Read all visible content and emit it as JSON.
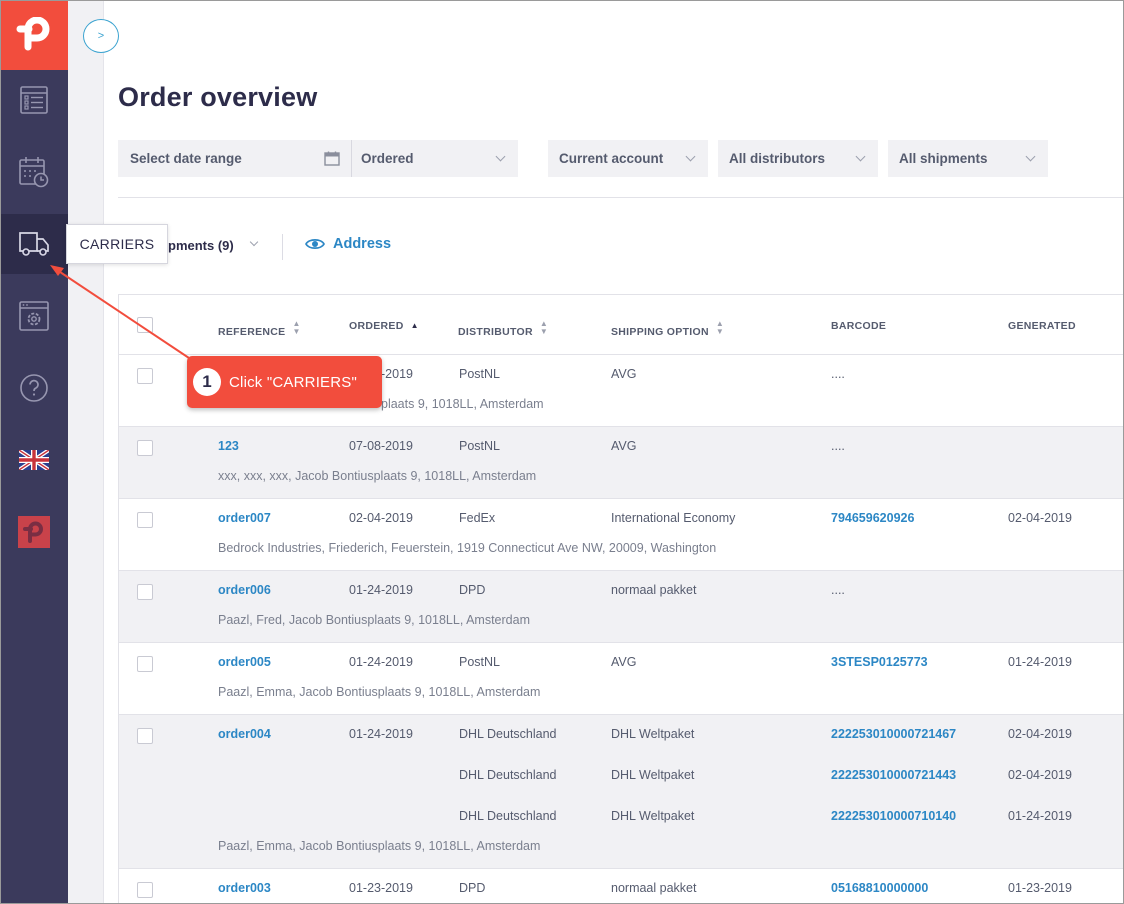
{
  "sidebar": {
    "items": [
      {
        "name": "orders",
        "icon": "orders-list-icon"
      },
      {
        "name": "calendar",
        "icon": "calendar-clock-icon"
      },
      {
        "name": "carriers",
        "icon": "truck-icon",
        "active": true
      },
      {
        "name": "settings",
        "icon": "settings-gear-icon"
      },
      {
        "name": "help",
        "icon": "help-question-icon"
      },
      {
        "name": "language",
        "icon": "uk-flag-icon"
      },
      {
        "name": "brand",
        "icon": "paazl-logo-icon"
      }
    ],
    "tooltip": "CARRIERS"
  },
  "toggle": {
    "label": ">"
  },
  "page": {
    "title": "Order overview"
  },
  "filters": {
    "date_range": "Select date range",
    "date_type": "Ordered",
    "account": "Current account",
    "distributors": "All distributors",
    "shipments": "All shipments"
  },
  "toolbar": {
    "shipments_label": "pments (9)",
    "address_label": "Address"
  },
  "table": {
    "headers": {
      "reference": "REFERENCE",
      "ordered": "ORDERED",
      "distributor": "DISTRIBUTOR",
      "shipping_option": "SHIPPING OPTION",
      "barcode": "BARCODE",
      "generated": "GENERATED"
    },
    "rows": [
      {
        "reference": "",
        "ordered": "-2019",
        "lines": [
          {
            "distributor": "PostNL",
            "shipping_option": "AVG",
            "barcode": "....",
            "generated": ""
          }
        ],
        "address": "plaats 9, 1018LL, Amsterdam"
      },
      {
        "reference": "123",
        "ordered": "07-08-2019",
        "lines": [
          {
            "distributor": "PostNL",
            "shipping_option": "AVG",
            "barcode": "....",
            "generated": ""
          }
        ],
        "address": "xxx, xxx, xxx, Jacob Bontiusplaats 9, 1018LL, Amsterdam"
      },
      {
        "reference": "order007",
        "ordered": "02-04-2019",
        "lines": [
          {
            "distributor": "FedEx",
            "shipping_option": "International Economy",
            "barcode": "794659620926",
            "generated": "02-04-2019"
          }
        ],
        "address": "Bedrock Industries, Friederich, Feuerstein, 1919 Connecticut Ave NW, 20009, Washington"
      },
      {
        "reference": "order006",
        "ordered": "01-24-2019",
        "lines": [
          {
            "distributor": "DPD",
            "shipping_option": "normaal pakket",
            "barcode": "....",
            "generated": ""
          }
        ],
        "address": "Paazl, Fred, Jacob Bontiusplaats 9, 1018LL, Amsterdam"
      },
      {
        "reference": "order005",
        "ordered": "01-24-2019",
        "lines": [
          {
            "distributor": "PostNL",
            "shipping_option": "AVG",
            "barcode": "3STESP0125773",
            "generated": "01-24-2019"
          }
        ],
        "address": "Paazl, Emma, Jacob Bontiusplaats 9, 1018LL, Amsterdam"
      },
      {
        "reference": "order004",
        "ordered": "01-24-2019",
        "lines": [
          {
            "distributor": "DHL Deutschland",
            "shipping_option": "DHL Weltpaket",
            "barcode": "222253010000721467",
            "generated": "02-04-2019"
          },
          {
            "distributor": "DHL Deutschland",
            "shipping_option": "DHL Weltpaket",
            "barcode": "222253010000721443",
            "generated": "02-04-2019"
          },
          {
            "distributor": "DHL Deutschland",
            "shipping_option": "DHL Weltpaket",
            "barcode": "222253010000710140",
            "generated": "01-24-2019"
          }
        ],
        "address": "Paazl, Emma, Jacob Bontiusplaats 9, 1018LL, Amsterdam"
      },
      {
        "reference": "order003",
        "ordered": "01-23-2019",
        "lines": [
          {
            "distributor": "DPD",
            "shipping_option": "normaal pakket",
            "barcode": "05168810000000",
            "generated": "01-23-2019"
          }
        ],
        "address": ""
      }
    ]
  },
  "annotation": {
    "number": "1",
    "text": "Click \"CARRIERS\""
  },
  "colors": {
    "brand": "#f24d3d",
    "sidebar": "#3b3a5c",
    "link": "#2c87c5",
    "row_alt": "#f1f1f4"
  }
}
